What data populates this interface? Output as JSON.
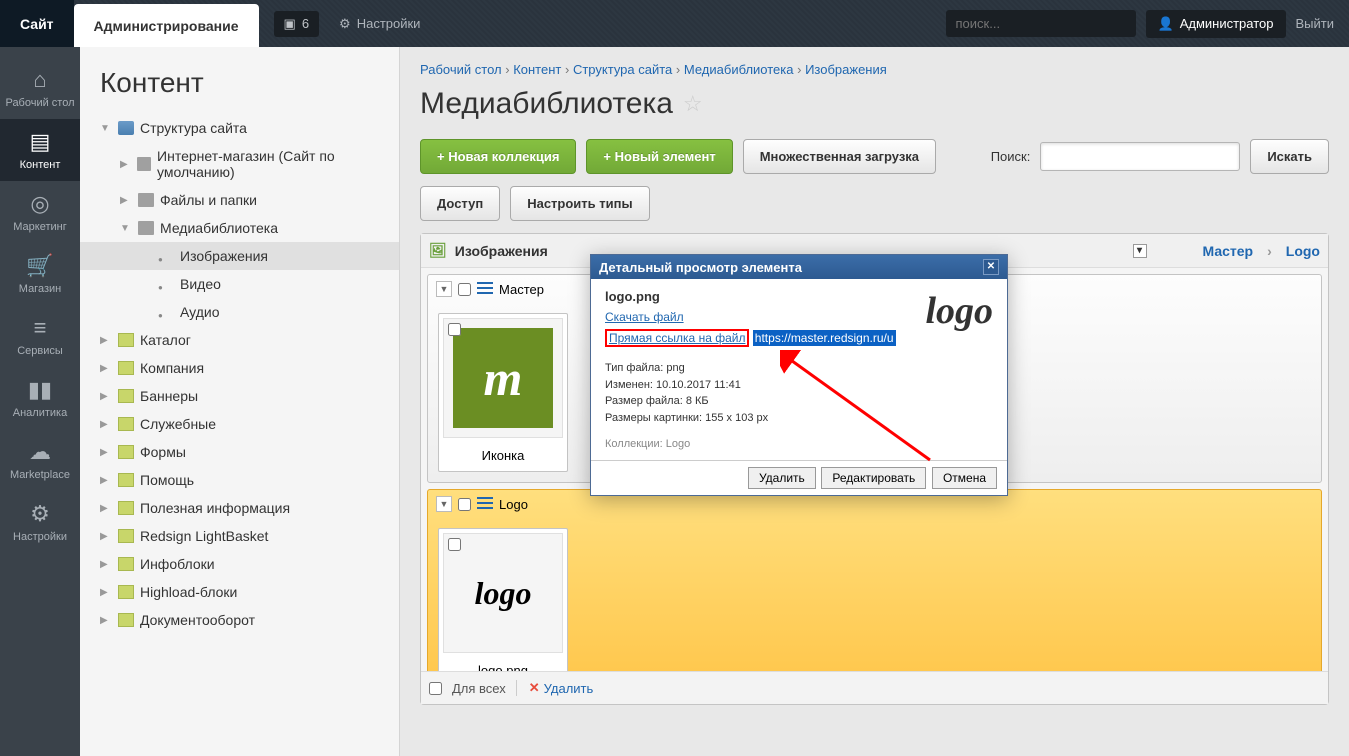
{
  "topbar": {
    "site": "Сайт",
    "admin": "Администрирование",
    "notif_count": "6",
    "settings": "Настройки",
    "search_placeholder": "поиск...",
    "user": "Администратор",
    "logout": "Выйти"
  },
  "rail": [
    {
      "label": "Рабочий стол",
      "icon": "⌂"
    },
    {
      "label": "Контент",
      "icon": "▤",
      "active": true
    },
    {
      "label": "Маркетинг",
      "icon": "◎"
    },
    {
      "label": "Магазин",
      "icon": "🛒"
    },
    {
      "label": "Сервисы",
      "icon": "≡"
    },
    {
      "label": "Аналитика",
      "icon": "▮▮"
    },
    {
      "label": "Marketplace",
      "icon": "☁"
    },
    {
      "label": "Настройки",
      "icon": "⚙"
    }
  ],
  "tree": {
    "title": "Контент",
    "nodes": [
      {
        "label": "Структура сайта",
        "indent": 0,
        "arrow": "▼",
        "ico": "site"
      },
      {
        "label": "Интернет-магазин (Сайт по умолчанию)",
        "indent": 1,
        "arrow": "▶",
        "ico": "folder"
      },
      {
        "label": "Файлы и папки",
        "indent": 1,
        "arrow": "▶",
        "ico": "folder"
      },
      {
        "label": "Медиабиблиотека",
        "indent": 1,
        "arrow": "▼",
        "ico": "folder"
      },
      {
        "label": "Изображения",
        "indent": 2,
        "arrow": "",
        "ico": "dot",
        "selected": true
      },
      {
        "label": "Видео",
        "indent": 2,
        "arrow": "",
        "ico": "dot"
      },
      {
        "label": "Аудио",
        "indent": 2,
        "arrow": "",
        "ico": "dot"
      },
      {
        "label": "Каталог",
        "indent": 0,
        "arrow": "▶",
        "ico": "page"
      },
      {
        "label": "Компания",
        "indent": 0,
        "arrow": "▶",
        "ico": "page"
      },
      {
        "label": "Баннеры",
        "indent": 0,
        "arrow": "▶",
        "ico": "page"
      },
      {
        "label": "Служебные",
        "indent": 0,
        "arrow": "▶",
        "ico": "page"
      },
      {
        "label": "Формы",
        "indent": 0,
        "arrow": "▶",
        "ico": "page"
      },
      {
        "label": "Помощь",
        "indent": 0,
        "arrow": "▶",
        "ico": "page"
      },
      {
        "label": "Полезная информация",
        "indent": 0,
        "arrow": "▶",
        "ico": "page"
      },
      {
        "label": "Redsign LightBasket",
        "indent": 0,
        "arrow": "▶",
        "ico": "page"
      },
      {
        "label": "Инфоблоки",
        "indent": 0,
        "arrow": "▶",
        "ico": "page"
      },
      {
        "label": "Highload-блоки",
        "indent": 0,
        "arrow": "▶",
        "ico": "page"
      },
      {
        "label": "Документооборот",
        "indent": 0,
        "arrow": "▶",
        "ico": "page"
      }
    ]
  },
  "crumbs": [
    "Рабочий стол",
    "Контент",
    "Структура сайта",
    "Медиабиблиотека",
    "Изображения"
  ],
  "page_title": "Медиабиблиотека",
  "toolbar": {
    "new_collection": "Новая коллекция",
    "new_element": "Новый элемент",
    "bulk": "Множественная загрузка",
    "search_label": "Поиск:",
    "search_btn": "Искать"
  },
  "subbar": {
    "access": "Доступ",
    "types": "Настроить типы"
  },
  "panel": {
    "dropdown": "Изображения",
    "crumb1": "Мастер",
    "crumb2": "Logo",
    "collections": [
      {
        "name": "Мастер",
        "active": false,
        "thumbs": [
          {
            "caption": "Иконка",
            "kind": "m"
          }
        ]
      },
      {
        "name": "Logo",
        "active": true,
        "thumbs": [
          {
            "caption": "logo.png",
            "kind": "logo"
          }
        ]
      }
    ]
  },
  "bottom": {
    "all": "Для всех",
    "delete": "Удалить"
  },
  "modal": {
    "title": "Детальный просмотр элемента",
    "filename": "logo.png",
    "download": "Скачать файл",
    "direct": "Прямая ссылка на файл",
    "url": "https://master.redsign.ru/u",
    "meta": {
      "type": "Тип файла: png",
      "modified": "Изменен: 10.10.2017 11:41",
      "size": "Размер файла: 8 КБ",
      "dims": "Размеры картинки: 155 x 103 px"
    },
    "collections_label": "Коллекции: Logo",
    "btn_delete": "Удалить",
    "btn_edit": "Редактировать",
    "btn_cancel": "Отмена"
  }
}
